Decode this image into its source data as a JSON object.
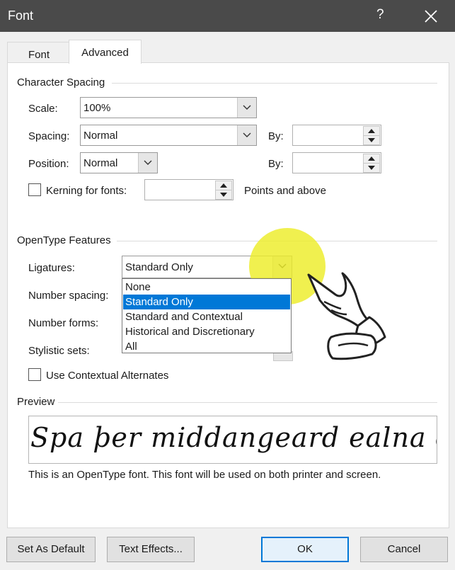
{
  "window": {
    "title": "Font",
    "help_glyph": "?"
  },
  "tabs": [
    {
      "label": "Font"
    },
    {
      "label": "Advanced"
    }
  ],
  "character_spacing": {
    "heading": "Character Spacing",
    "scale": {
      "label": "Scale:",
      "value": "100%"
    },
    "spacing": {
      "label": "Spacing:",
      "value": "Normal",
      "by_label": "By:",
      "by_value": ""
    },
    "position": {
      "label": "Position:",
      "value": "Normal",
      "by_label": "By:",
      "by_value": ""
    },
    "kerning": {
      "label": "Kerning for fonts:",
      "value": "",
      "suffix": "Points and above",
      "checked": false
    }
  },
  "opentype": {
    "heading": "OpenType Features",
    "ligatures": {
      "label": "Ligatures:",
      "value": "Standard Only",
      "options": [
        "None",
        "Standard Only",
        "Standard and Contextual",
        "Historical and Discretionary",
        "All"
      ],
      "selected_index": 1
    },
    "number_spacing": {
      "label": "Number spacing:"
    },
    "number_forms": {
      "label": "Number forms:"
    },
    "stylistic_sets": {
      "label": "Stylistic sets:"
    },
    "contextual_alternates": {
      "label": "Use Contextual Alternates",
      "checked": false
    }
  },
  "preview": {
    "heading": "Preview",
    "sample": "Spa þer middangeard ealna dogra gehpa",
    "note": "This is an OpenType font. This font will be used on both printer and screen."
  },
  "buttons": {
    "set_default": "Set As Default",
    "text_effects": "Text Effects...",
    "ok": "OK",
    "cancel": "Cancel"
  },
  "colors": {
    "titlebar": "#4a4a4a",
    "selection": "#0078d7",
    "highlight": "#eded28"
  },
  "icons": {
    "close": "close-icon",
    "help": "help-icon",
    "chevron": "chevron-down-icon",
    "pointer": "pointing-hand-icon"
  }
}
